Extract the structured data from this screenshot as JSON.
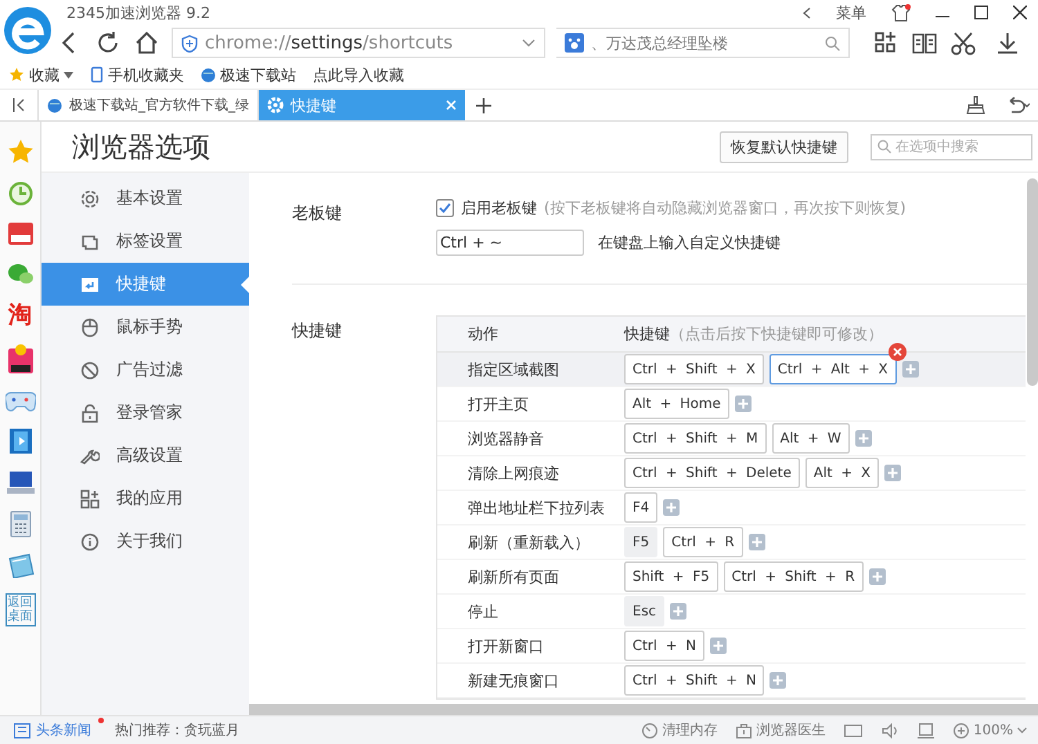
{
  "window": {
    "title": "2345加速浏览器 9.2",
    "menu_label": "菜单"
  },
  "address_bar": {
    "prefix": "chrome://",
    "host": "settings",
    "path": "/shortcuts"
  },
  "search_box": {
    "placeholder": "、万达茂总经理坠楼"
  },
  "bookmarks": [
    {
      "label": "收藏",
      "kind": "menu"
    },
    {
      "label": "手机收藏夹",
      "kind": "phone"
    },
    {
      "label": "极速下载站",
      "kind": "site"
    },
    {
      "label": "点此导入收藏",
      "kind": "plain"
    }
  ],
  "tabs": [
    {
      "label": "极速下载站_官方软件下载_绿",
      "selected": false,
      "kind": "site"
    },
    {
      "label": "快捷键",
      "selected": true,
      "kind": "settings"
    }
  ],
  "side_apps": [
    {
      "kind": "star"
    },
    {
      "kind": "clock"
    },
    {
      "kind": "news"
    },
    {
      "kind": "chat"
    },
    {
      "kind": "taobao",
      "label": "淘"
    },
    {
      "kind": "discount"
    },
    {
      "kind": "gamepad"
    },
    {
      "kind": "film"
    },
    {
      "kind": "computer"
    },
    {
      "kind": "calculator"
    },
    {
      "kind": "notebook"
    },
    {
      "kind": "desktop",
      "label": "返回桌面"
    }
  ],
  "settings": {
    "title": "浏览器选项",
    "restore_button": "恢复默认快捷键",
    "search": {
      "placeholder": "在选项中搜索"
    },
    "nav": [
      {
        "label": "基本设置",
        "kind": "gear",
        "selected": false
      },
      {
        "label": "标签设置",
        "kind": "tabs",
        "selected": false
      },
      {
        "label": "快捷键",
        "kind": "key",
        "selected": true
      },
      {
        "label": "鼠标手势",
        "kind": "mouse",
        "selected": false
      },
      {
        "label": "广告过滤",
        "kind": "ban",
        "selected": false
      },
      {
        "label": "登录管家",
        "kind": "lock",
        "selected": false
      },
      {
        "label": "高级设置",
        "kind": "wrench",
        "selected": false
      },
      {
        "label": "我的应用",
        "kind": "apps",
        "selected": false
      },
      {
        "label": "关于我们",
        "kind": "info",
        "selected": false
      }
    ],
    "boss_key": {
      "label": "老板键",
      "checkbox_label": "启用老板键",
      "checked": true,
      "hint": "(按下老板键将自动隐藏浏览器窗口，再次按下则恢复)",
      "value": "Ctrl + ~",
      "instruction": "在键盘上输入自定义快捷键"
    },
    "shortcuts": {
      "label": "快捷键",
      "columns": [
        "动作",
        "快捷键"
      ],
      "column_hint": "（点击后按下快捷键即可修改）",
      "rows": [
        {
          "action": "指定区域截图",
          "selected": true,
          "keys": [
            {
              "text": "Ctrl + Shift + X",
              "fixed": false,
              "editing": false
            },
            {
              "text": "Ctrl + Alt + X",
              "fixed": false,
              "editing": true
            }
          ]
        },
        {
          "action": "打开主页",
          "selected": false,
          "keys": [
            {
              "text": "Alt + Home",
              "fixed": false,
              "editing": false
            }
          ]
        },
        {
          "action": "浏览器静音",
          "selected": false,
          "keys": [
            {
              "text": "Ctrl + Shift + M",
              "fixed": false,
              "editing": false
            },
            {
              "text": "Alt + W",
              "fixed": false,
              "editing": false
            }
          ]
        },
        {
          "action": "清除上网痕迹",
          "selected": false,
          "keys": [
            {
              "text": "Ctrl + Shift + Delete",
              "fixed": false,
              "editing": false
            },
            {
              "text": "Alt + X",
              "fixed": false,
              "editing": false
            }
          ]
        },
        {
          "action": "弹出地址栏下拉列表",
          "selected": false,
          "keys": [
            {
              "text": "F4",
              "fixed": false,
              "editing": false
            }
          ]
        },
        {
          "action": "刷新（重新载入）",
          "selected": false,
          "keys": [
            {
              "text": "F5",
              "fixed": true,
              "editing": false
            },
            {
              "text": "Ctrl + R",
              "fixed": false,
              "editing": false
            }
          ]
        },
        {
          "action": "刷新所有页面",
          "selected": false,
          "keys": [
            {
              "text": "Shift + F5",
              "fixed": false,
              "editing": false
            },
            {
              "text": "Ctrl + Shift + R",
              "fixed": false,
              "editing": false
            }
          ]
        },
        {
          "action": "停止",
          "selected": false,
          "keys": [
            {
              "text": "Esc",
              "fixed": true,
              "editing": false
            }
          ]
        },
        {
          "action": "打开新窗口",
          "selected": false,
          "keys": [
            {
              "text": "Ctrl + N",
              "fixed": false,
              "editing": false
            }
          ]
        },
        {
          "action": "新建无痕窗口",
          "selected": false,
          "keys": [
            {
              "text": "Ctrl + Shift + N",
              "fixed": false,
              "editing": false
            }
          ]
        }
      ]
    }
  },
  "status_bar": {
    "news": "头条新闻",
    "news_unread": true,
    "hot": "热门推荐：贪玩蓝月",
    "clean": "清理内存",
    "doctor": "浏览器医生",
    "zoom": "100%"
  }
}
